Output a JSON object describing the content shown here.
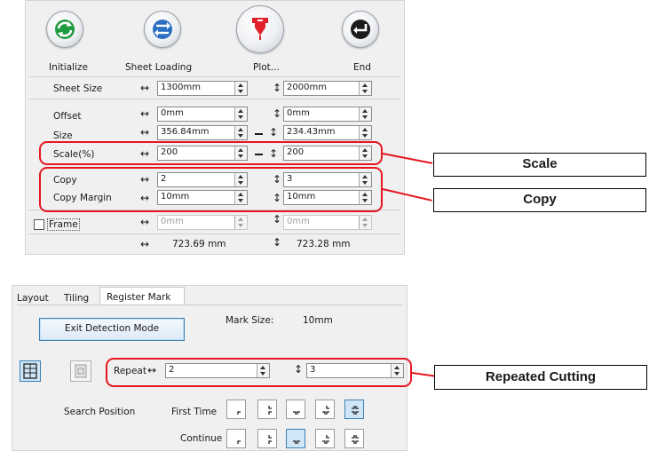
{
  "toolbar": {
    "initialize": "Initialize",
    "sheet_loading": "Sheet Loading",
    "plot": "Plot...",
    "end": "End"
  },
  "rows": {
    "sheet_size": {
      "label": "Sheet Size",
      "w": "1300mm",
      "h": "2000mm"
    },
    "offset": {
      "label": "Offset",
      "w": "0mm",
      "h": "0mm"
    },
    "size": {
      "label": "Size",
      "w": "356.84mm",
      "h": "234.43mm"
    },
    "scale": {
      "label": "Scale(%)",
      "w": "200",
      "h": "200"
    },
    "copy": {
      "label": "Copy",
      "w": "2",
      "h": "3"
    },
    "copy_margin": {
      "label": "Copy Margin",
      "w": "10mm",
      "h": "10mm"
    },
    "frame": {
      "label": "Frame",
      "w": "0mm",
      "h": "0mm",
      "checked": false
    },
    "total": {
      "w": "723.69 mm",
      "h": "723.28 mm"
    }
  },
  "glyphs": {
    "horizontal_arrow": "↔",
    "vertical_arrow": "↕"
  },
  "callouts": {
    "scale": "Scale",
    "copy": "Copy",
    "repeated_cutting": "Repeated Cutting"
  },
  "tabs": [
    "Layout",
    "Tiling",
    "Register Mark"
  ],
  "register": {
    "exit_button": "Exit Detection Mode",
    "mark_size_label": "Mark Size:",
    "mark_size_value": "10mm",
    "repeat_label": "Repeat",
    "repeat_w": "2",
    "repeat_h": "3",
    "search_position_label": "Search Position",
    "first_time_label": "First Time",
    "continue_label": "Continue",
    "first_time_selected": 5,
    "continue_selected": 3
  },
  "colors": {
    "highlight_red": "#e5161f",
    "accent_blue": "#3c7fb1",
    "initialize_green": "#1f9a3e",
    "sheet_loading_blue": "#2b6fc2",
    "plot_red": "#e0202a"
  }
}
